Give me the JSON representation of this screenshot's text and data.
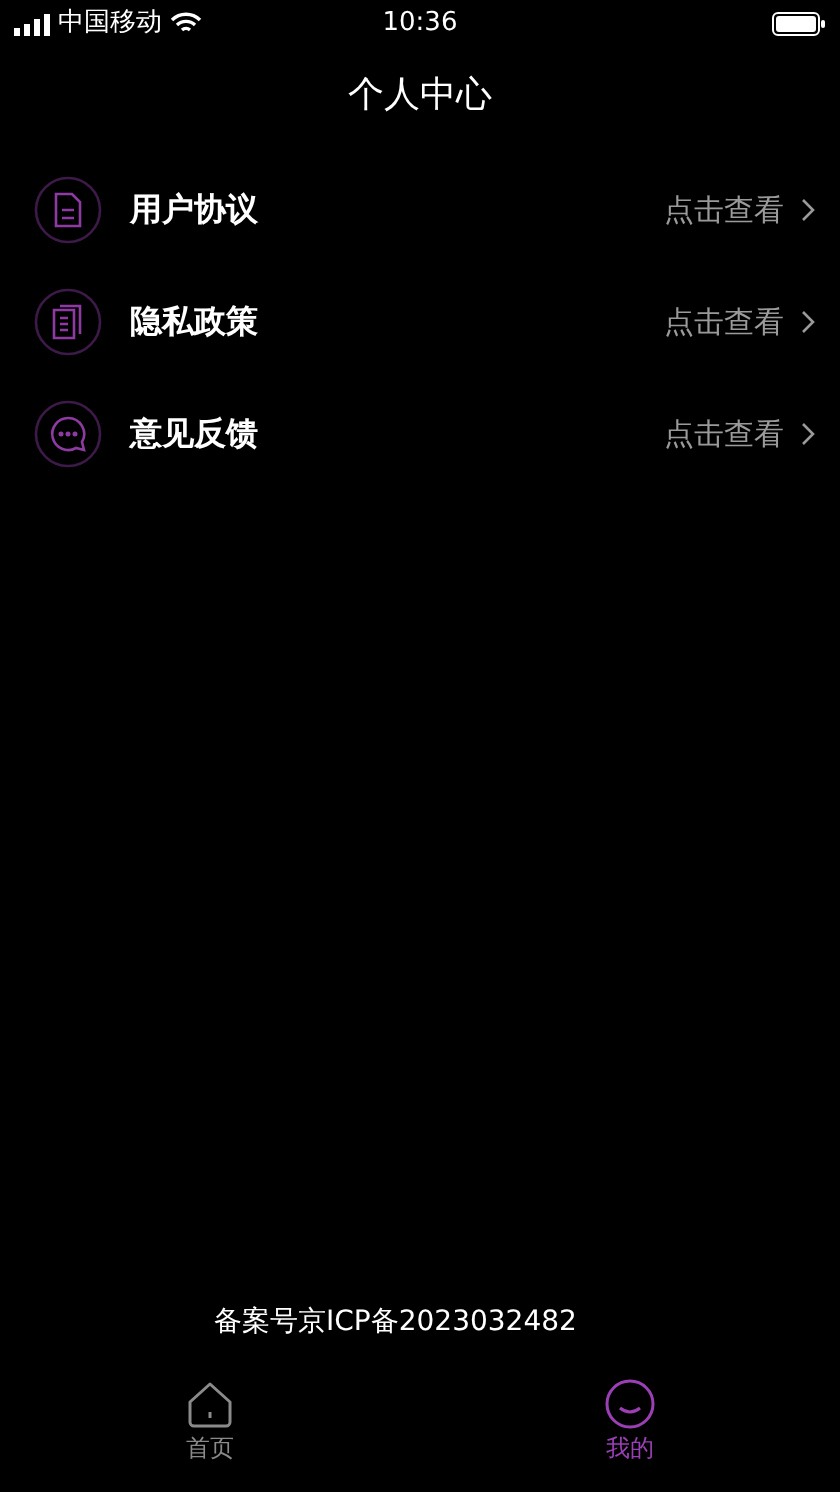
{
  "status_bar": {
    "carrier": "中国移动",
    "time": "10:36"
  },
  "header": {
    "title": "个人中心"
  },
  "menu": [
    {
      "kind": "document",
      "label": "用户协议",
      "action": "点击查看"
    },
    {
      "kind": "pages",
      "label": "隐私政策",
      "action": "点击查看"
    },
    {
      "kind": "chat",
      "label": "意见反馈",
      "action": "点击查看"
    }
  ],
  "footer": {
    "record": "备案号京ICP备2023032482"
  },
  "tab_bar": [
    {
      "kind": "home",
      "label": "首页",
      "selected": false
    },
    {
      "kind": "me",
      "label": "我的",
      "selected": true
    }
  ]
}
